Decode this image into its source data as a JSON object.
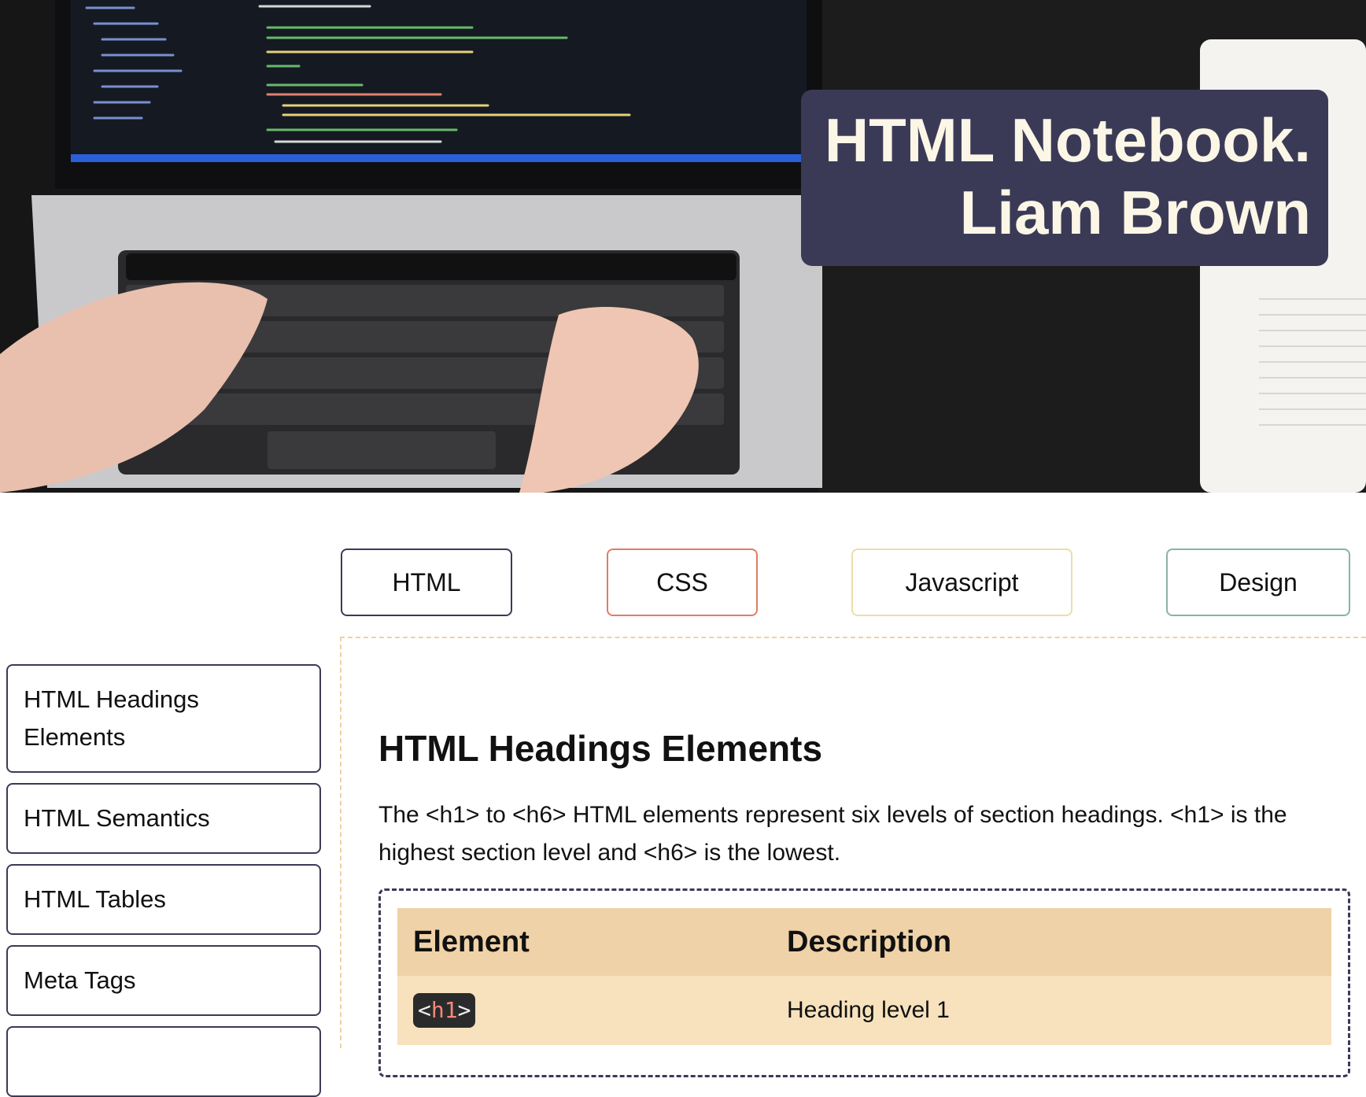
{
  "hero": {
    "title_line1": "HTML Notebook.",
    "title_line2": "Liam Brown",
    "title_bg": "#3b3a56",
    "title_color": "#fbf6e6"
  },
  "tabs": [
    {
      "label": "HTML",
      "border_color": "#3b3a56"
    },
    {
      "label": "CSS",
      "border_color": "#e07d64"
    },
    {
      "label": "Javascript",
      "border_color": "#eedcae"
    },
    {
      "label": "Design",
      "border_color": "#87b3a4"
    }
  ],
  "sidebar": {
    "items": [
      {
        "label": "HTML Headings Elements"
      },
      {
        "label": "HTML Semantics"
      },
      {
        "label": "HTML Tables"
      },
      {
        "label": "Meta Tags"
      },
      {
        "label": ""
      }
    ]
  },
  "main": {
    "heading": "HTML Headings Elements",
    "paragraph": "The <h1> to <h6> HTML elements represent six levels of section headings. <h1> is the highest section level and <h6> is the lowest.",
    "table": {
      "headers": [
        "Element",
        "Description"
      ],
      "rows": [
        {
          "element_open": "<",
          "element_name": "h1",
          "element_close": ">",
          "description": "Heading level 1"
        }
      ]
    }
  }
}
